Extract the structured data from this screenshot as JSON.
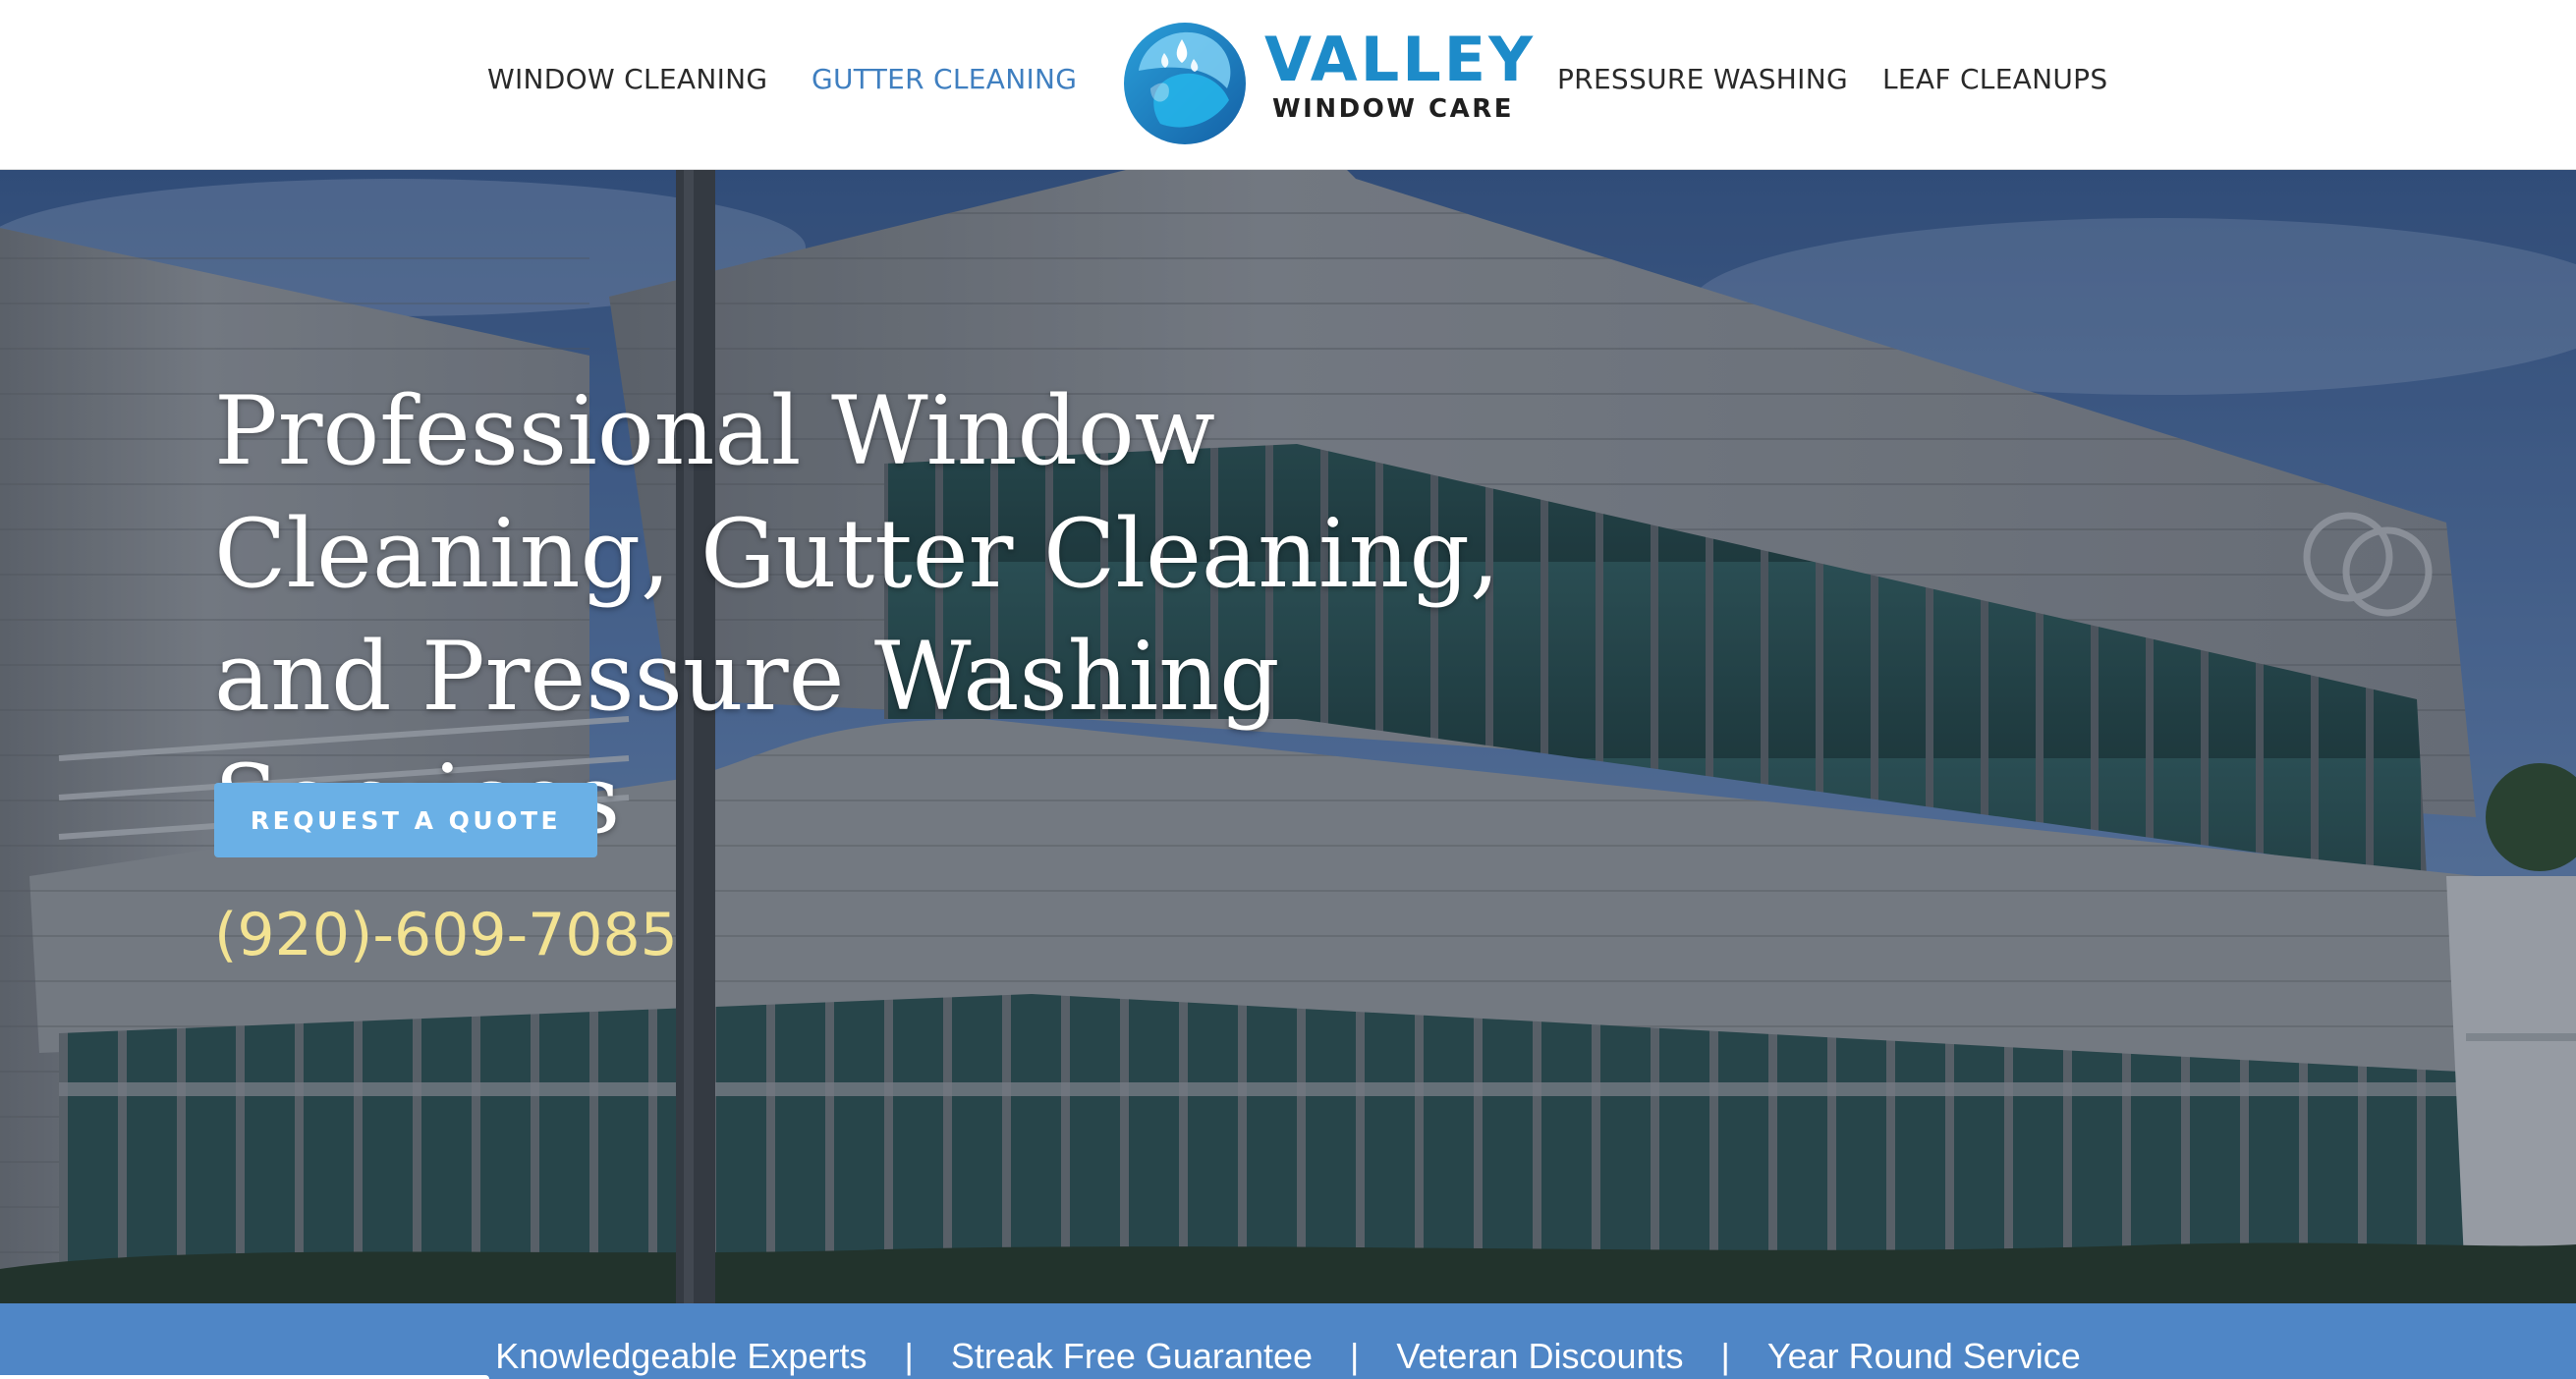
{
  "nav": {
    "left": [
      {
        "label": "WINDOW CLEANING"
      },
      {
        "label": "GUTTER CLEANING",
        "active": true
      }
    ],
    "right": [
      {
        "label": "PRESSURE WASHING"
      },
      {
        "label": "LEAF CLEANUPS"
      }
    ],
    "active_color": "#3f7fc0"
  },
  "logo": {
    "title": "VALLEY",
    "subtitle": "WINDOW CARE",
    "brand_color": "#1d8bc9"
  },
  "hero": {
    "title": "Professional Window Cleaning, Gutter Cleaning, and Pressure Washing Services",
    "cta_label": "REQUEST A QUOTE",
    "phone": "(920)-609-7085",
    "phone_color": "#f3e392",
    "cta_color": "#6ab0e6"
  },
  "features": {
    "items": [
      "Knowledgeable Experts",
      "Streak Free Guarantee",
      "Veteran Discounts",
      "Year Round Service"
    ],
    "separator": "|",
    "background": "#4f86c6"
  }
}
